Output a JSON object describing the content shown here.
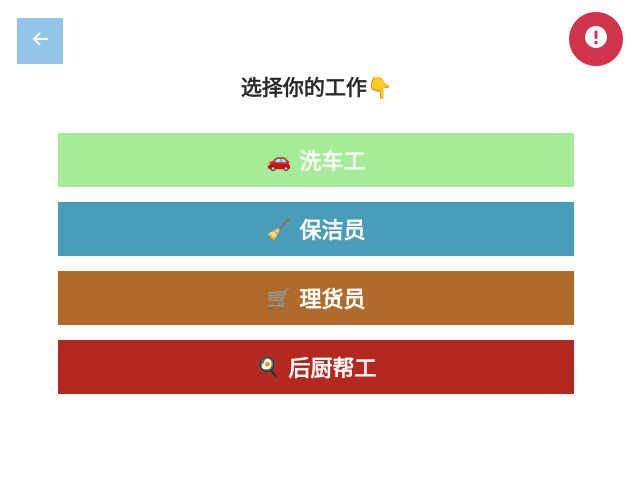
{
  "header": {
    "back_icon": "arrow-left-icon",
    "alert_icon": "exclamation-circle-icon",
    "back_color": "#92c5e8",
    "alert_color": "#d0334a"
  },
  "title": "选择你的工作👇",
  "jobs": [
    {
      "icon": "🚗",
      "label": "洗车工",
      "color": "#a6ec98"
    },
    {
      "icon": "🧹",
      "label": "保洁员",
      "color": "#4a9db9"
    },
    {
      "icon": "🛒",
      "label": "理货员",
      "color": "#b06a2c"
    },
    {
      "icon": "🍳",
      "label": "后厨帮工",
      "color": "#b5281f"
    }
  ]
}
